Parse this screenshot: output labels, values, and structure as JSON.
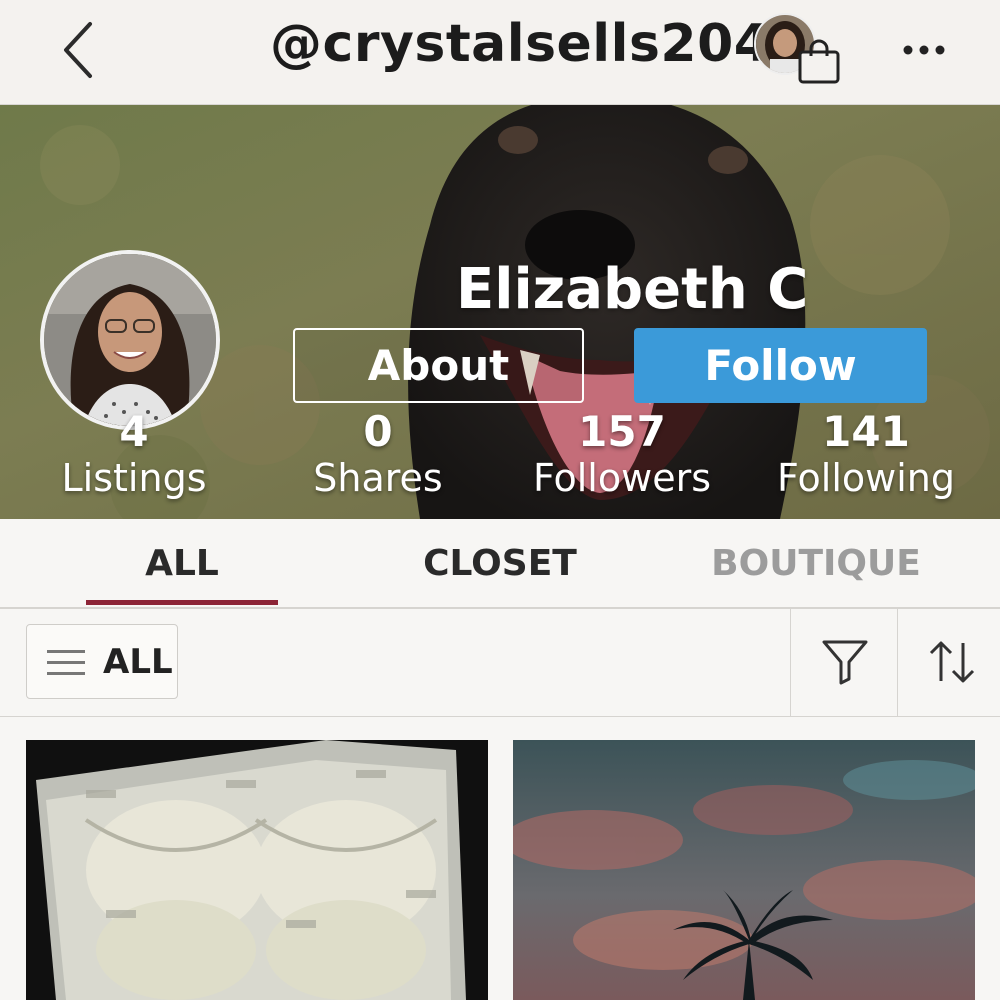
{
  "header": {
    "handle": "@crystalsells204",
    "back_icon": "chevron-left-icon",
    "more_icon": "more-horizontal-icon",
    "bag_icon": "shopping-bag-icon"
  },
  "profile": {
    "display_name": "Elizabeth C",
    "about_label": "About",
    "follow_label": "Follow",
    "follow_color": "#3b9ad9"
  },
  "stats": [
    {
      "value": "4",
      "label": "Listings"
    },
    {
      "value": "0",
      "label": "Shares"
    },
    {
      "value": "157",
      "label": "Followers"
    },
    {
      "value": "141",
      "label": "Following"
    }
  ],
  "tabs": [
    {
      "label": "ALL",
      "active": true
    },
    {
      "label": "CLOSET",
      "active": false
    },
    {
      "label": "BOUTIQUE",
      "active": false
    }
  ],
  "tab_accent": "#8c2436",
  "filters": {
    "category_label": "ALL",
    "menu_icon": "hamburger-icon",
    "filter_icon": "funnel-icon",
    "sort_icon": "sort-arrows-icon"
  }
}
